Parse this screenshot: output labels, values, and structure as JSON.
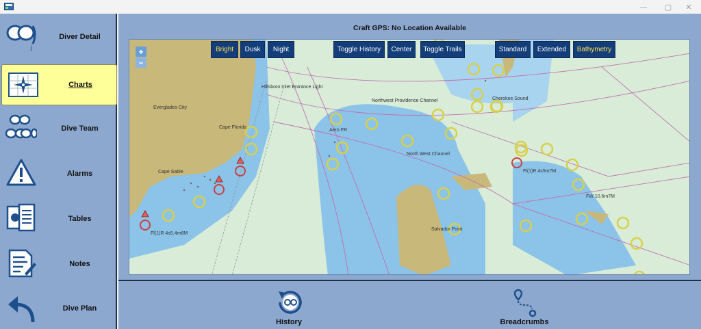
{
  "window": {
    "minimize_glyph": "—",
    "maximize_glyph": "▢",
    "close_glyph": "✕"
  },
  "sidebar": {
    "items": [
      {
        "label": "Diver Detail",
        "icon": "diver-mask-icon"
      },
      {
        "label": "Charts",
        "icon": "chart-compass-icon",
        "active": true
      },
      {
        "label": "Dive Team",
        "icon": "dive-team-icon"
      },
      {
        "label": "Alarms",
        "icon": "warning-triangle-icon"
      },
      {
        "label": "Tables",
        "icon": "dive-tables-icon"
      },
      {
        "label": "Notes",
        "icon": "notes-icon"
      },
      {
        "label": "Dive Plan",
        "icon": "back-arrow-icon"
      }
    ]
  },
  "gps_status": "Craft GPS: No Location Available",
  "toolbar": {
    "bright": "Bright",
    "dusk": "Dusk",
    "night": "Night",
    "toggle_history": "Toggle History",
    "center": "Center",
    "toggle_trails": "Toggle Trails",
    "standard": "Standard",
    "extended": "Extended",
    "bathymetry": "Bathymetry"
  },
  "zoom": {
    "in": "+",
    "out": "−"
  },
  "map_labels": {
    "hillsboro": "Hillsboro Inlet Entrance Light",
    "everglades": "Everglades City",
    "cape_florida": "Cape Florida",
    "cape_sable": "Cape Sable",
    "aero": "Aero FR",
    "nw_providence": "Northwest Providence Channel",
    "north_west_channel": "North West Channel",
    "cherokee": "Cherokee Sound",
    "fl_4s5m7m": "Fl(1)R 4s5m7M",
    "fw": "FW 10.6m7M",
    "salvador": "Salvador Point",
    "fl_4s5_4m6m": "Fl(1)R 4s5.4m6M"
  },
  "bottom_buttons": {
    "history": "History",
    "breadcrumbs": "Breadcrumbs"
  },
  "colors": {
    "sidebar_bg": "#8da8cf",
    "active_item_bg": "#ffff99",
    "button_bg": "#133e7a",
    "active_button_text": "#ffe14d",
    "land": "#c8b87a",
    "shallow_water": "#8cc3e8",
    "deep_water": "#d8ecd8"
  }
}
